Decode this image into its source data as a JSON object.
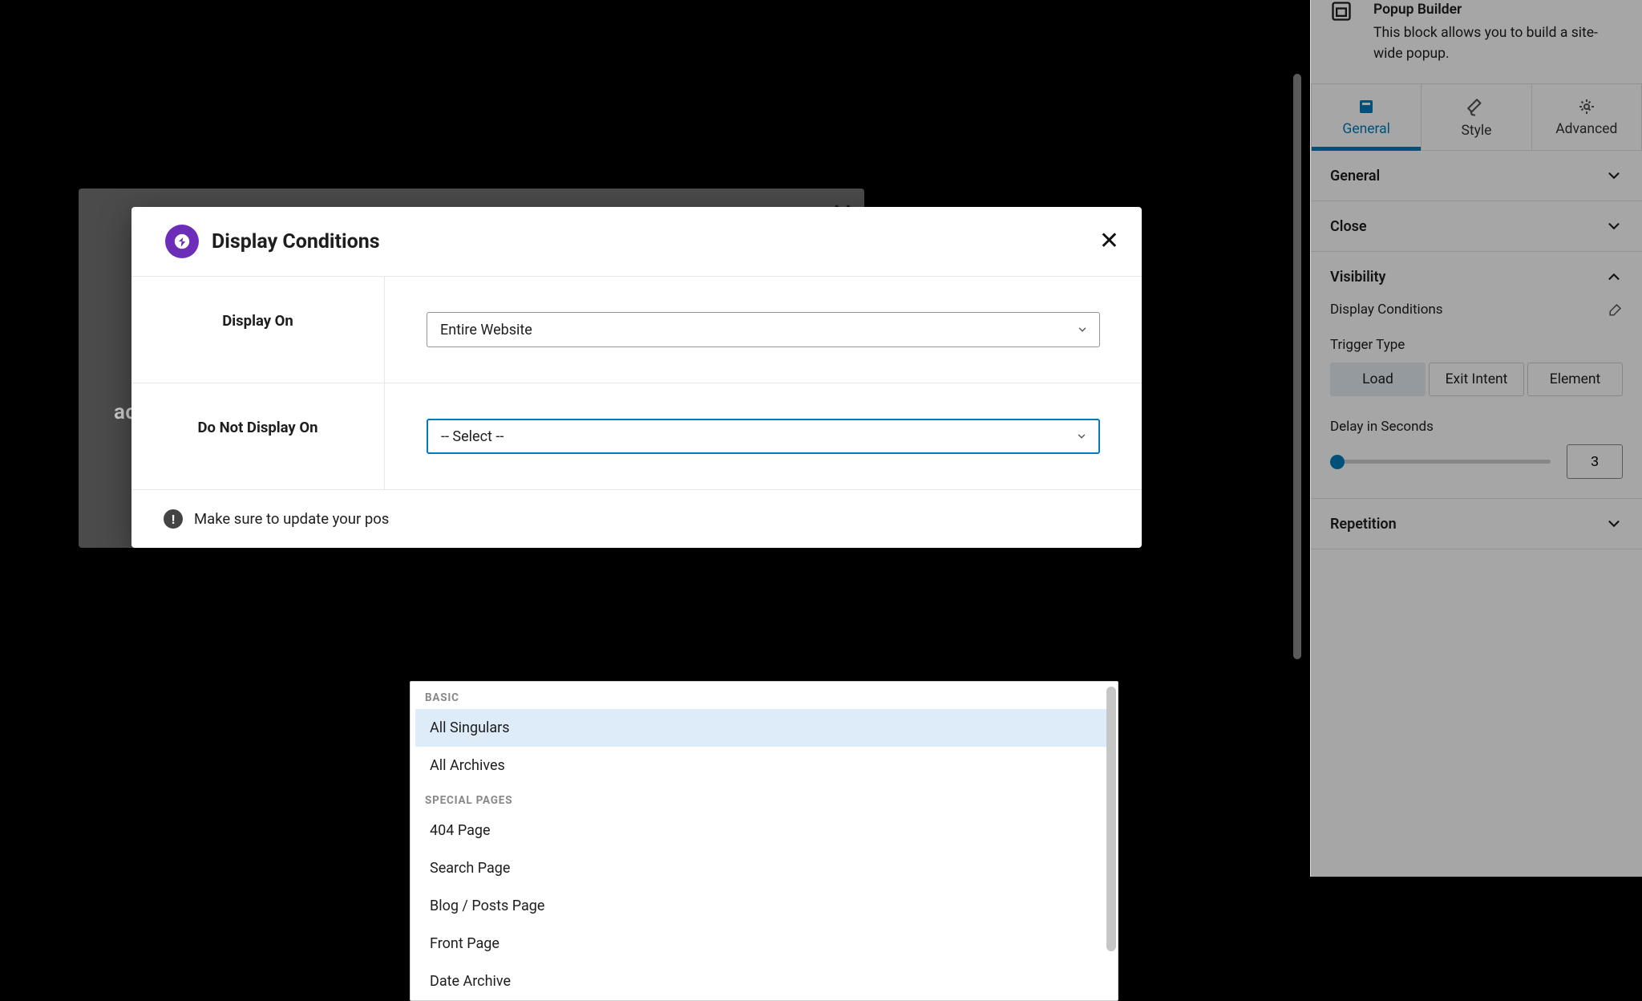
{
  "block_info": {
    "title": "Popup Builder",
    "description": "This block allows you to build a site-wide popup."
  },
  "tabs": {
    "general": "General",
    "style": "Style",
    "advanced": "Advanced"
  },
  "panels": {
    "general_section": "General",
    "close_section": "Close",
    "visibility_section": "Visibility",
    "repetition_section": "Repetition"
  },
  "visibility": {
    "display_conditions_label": "Display Conditions",
    "trigger_type_label": "Trigger Type",
    "trigger_options": {
      "load": "Load",
      "exit": "Exit Intent",
      "element": "Element"
    },
    "delay_label": "Delay in Seconds",
    "delay_value": "3"
  },
  "behind_modal": {
    "text_fragment": "ac"
  },
  "modal": {
    "title": "Display Conditions",
    "rows": {
      "display_on": {
        "label": "Display On",
        "value": "Entire Website"
      },
      "do_not_display_on": {
        "label": "Do Not Display On",
        "value": "-- Select --"
      }
    },
    "footer_hint": "Make sure to update your pos"
  },
  "dropdown": {
    "groups": [
      {
        "label": "BASIC",
        "options": [
          {
            "label": "All Singulars",
            "highlight": true
          },
          {
            "label": "All Archives",
            "highlight": false
          }
        ]
      },
      {
        "label": "SPECIAL PAGES",
        "options": [
          {
            "label": "404 Page",
            "highlight": false
          },
          {
            "label": "Search Page",
            "highlight": false
          },
          {
            "label": "Blog / Posts Page",
            "highlight": false
          },
          {
            "label": "Front Page",
            "highlight": false
          },
          {
            "label": "Date Archive",
            "highlight": false
          }
        ]
      }
    ]
  },
  "icons": {
    "close_x": "✕"
  }
}
